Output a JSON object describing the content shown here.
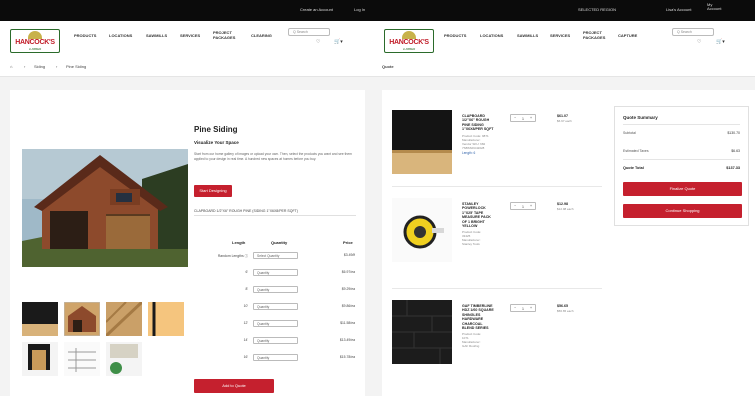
{
  "topbar": {
    "left": [
      "Create an Account",
      "Log In"
    ],
    "right": [
      "SELECTED REGION",
      "Lisa's Account"
    ],
    "badge": "My\nAccount"
  },
  "header_left": {
    "logo": "HANCOCK'S",
    "logo_sub": "LUMBER",
    "nav": [
      "PRODUCTS",
      "LOCATIONS",
      "SAWMILLS",
      "SERVICES",
      "PROJECT PACKAGES",
      "CLEARING"
    ],
    "search_placeholder": "Q  Search",
    "icons": [
      "♡",
      "🛒▾"
    ]
  },
  "header_right": {
    "logo": "HANCOCK'S",
    "logo_sub": "LUMBER",
    "nav": [
      "PRODUCTS",
      "LOCATIONS",
      "SAWMILLS",
      "SERVICES",
      "PROJECT PACKAGES",
      "CAPTURE"
    ],
    "search_placeholder": "Q  Search",
    "icons": [
      "♡",
      "🛒▾"
    ]
  },
  "breadcrumb_left": [
    "⌂",
    "›",
    "Siding",
    "›",
    "Pine Siding"
  ],
  "breadcrumb_right": "Quote",
  "product": {
    "title": "Pine Siding",
    "subtitle": "Visualize Your Space",
    "description": "Start from our home gallery of images or upload your own. Then, select the products you want and see them applied to your design in real time. A hundred new spaces at homes before you buy.",
    "start_button": "Start Designing",
    "variant": "CLAPBOARD 1/2\"X6\" ROUGH PINE (SIDING 1\"X6X8/PER SQFT)",
    "table_headers": [
      "Length",
      "Quantity",
      "Price"
    ],
    "rows": [
      {
        "length": "Random Lengths ⓘ",
        "qty": "Select Quantity",
        "price": "$3.49/lf"
      },
      {
        "length": "6'",
        "qty": "Quantity",
        "price": "$6.97/ea"
      },
      {
        "length": "8'",
        "qty": "Quantity",
        "price": "$9.29/ea"
      },
      {
        "length": "10'",
        "qty": "Quantity",
        "price": "$9.86/ea"
      },
      {
        "length": "12'",
        "qty": "Quantity",
        "price": "$11.58/ea"
      },
      {
        "length": "14'",
        "qty": "Quantity",
        "price": "$13.49/ea"
      },
      {
        "length": "16'",
        "qty": "Quantity",
        "price": "$15.78/ea"
      }
    ],
    "add_button": "Add to Quote"
  },
  "quote_items": [
    {
      "name": [
        "CLAPBOARD",
        "1/2\"X6\" ROUGH",
        "PINE SIDING",
        "1\"X6X8/PER SQFT"
      ],
      "meta": [
        "Product Code: 9871",
        "Manufacturer:",
        "Vendor SKU: 682",
        "7SBSSRU42028"
      ],
      "link": "Length: 6",
      "qty": "1",
      "price": "$61.07",
      "price_sub": "$6.97 each"
    },
    {
      "name": [
        "STANLEY",
        "POWERLOCK",
        "1\"X25' TAPE",
        "MEASURE PACK",
        "OF 1 BRIGHT",
        "YELLOW"
      ],
      "meta": [
        "Product Code:",
        "33425",
        "Manufacturer:",
        "Stanley Tools"
      ],
      "link": "",
      "qty": "1",
      "price": "$12.98",
      "price_sub": "$12.98 each"
    },
    {
      "name": [
        "GAF TIMBERLINE",
        "HDZ 1/60 SQUARE",
        "SHINGLES",
        "HARDWARE",
        "CHARCOAL",
        "BLEND SERIES"
      ],
      "meta": [
        "Product Code:",
        "1071",
        "Manufacturer:",
        "GAF Roofing"
      ],
      "link": "",
      "qty": "1",
      "price": "$56.65",
      "price_sub": "$56.65 each"
    }
  ],
  "summary": {
    "title": "Quote Summary",
    "subtotal_label": "Subtotal",
    "subtotal": "$130.70",
    "tax_label": "Estimated Taxes",
    "tax": "$6.63",
    "total_label": "Quote Total",
    "total": "$137.33",
    "primary_button": "Finalize Quote",
    "secondary_button": "Continue Shopping"
  },
  "colors": {
    "accent": "#c5202e",
    "topbar": "#0b0b0b",
    "logo_green": "#2b6b2b"
  }
}
